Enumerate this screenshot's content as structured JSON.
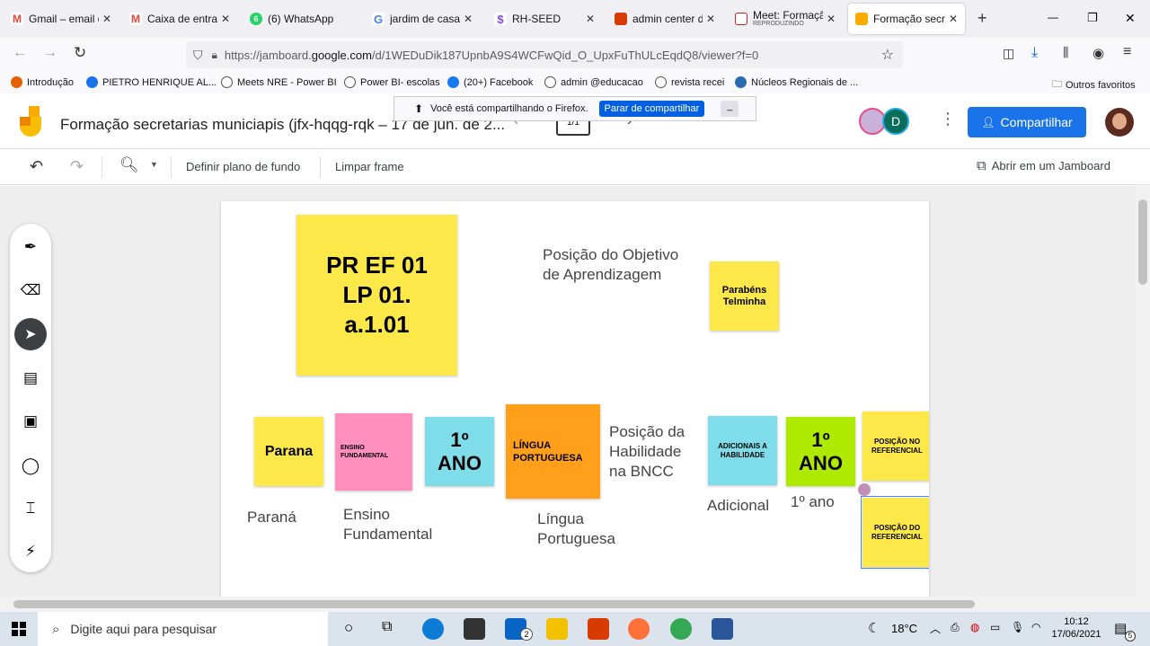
{
  "browser": {
    "tabs": [
      {
        "label": "Gmail – email d",
        "icon": "gmail-icon",
        "color": "#ea4335"
      },
      {
        "label": "Caixa de entrad",
        "icon": "gmail-icon",
        "color": "#ea4335"
      },
      {
        "label": "(6) WhatsApp",
        "icon": "whatsapp-icon",
        "color": "#25d366"
      },
      {
        "label": "jardim de casa d",
        "icon": "google-icon",
        "color": "#4285f4"
      },
      {
        "label": "RH-SEED",
        "icon": "dollar-icon",
        "color": "#7b4fd8"
      },
      {
        "label": "admin center do",
        "icon": "office-icon",
        "color": "#d83b01"
      },
      {
        "label": "Meet: Formação",
        "sublabel": "REPRODUZINDO",
        "icon": "meet-icon",
        "color": "#c5221f"
      },
      {
        "label": "Formação secret",
        "icon": "jamboard-icon",
        "color": "#f9ab00"
      }
    ],
    "new_tab": "+",
    "window": {
      "minimize": "—",
      "restore": "❐",
      "close": "✕"
    },
    "url": {
      "prefix": "https://jamboard.",
      "domain": "google.com",
      "rest": "/d/1WEDuDik187UpnbA9S4WCFwQid_O_UpxFuThULcEqdQ8/viewer?f=0"
    },
    "bookmarks": [
      {
        "label": "Introdução",
        "color": "#e66000"
      },
      {
        "label": "PIETRO HENRIQUE AL...",
        "color": "#1a73e8"
      },
      {
        "label": "Meets NRE - Power BI",
        "color": "#666"
      },
      {
        "label": "Power BI- escolas",
        "color": "#666"
      },
      {
        "label": "(20+) Facebook",
        "color": "#1877f2"
      },
      {
        "label": "admin @educacao",
        "color": "#666"
      },
      {
        "label": "revista recei",
        "color": "#666"
      },
      {
        "label": "Núcleos Regionais de ...",
        "color": "#2b6cb0"
      }
    ],
    "other_bookmarks": "Outros favoritos"
  },
  "share_banner": {
    "text": "Você está compartilhando o Firefox.",
    "button": "Parar de compartilhar",
    "minimize": "_"
  },
  "jamboard": {
    "title": "Formação secretarias municiapis (jfx-hqqg-rqk – 17 de jun. de 2...",
    "frame_counter": "1/1",
    "avatar_letter": "D",
    "share_button": "Compartilhar",
    "toolbar": {
      "set_background": "Definir plano de fundo",
      "clear_frame": "Limpar frame",
      "open_in_jamboard": "Abrir em um Jamboard"
    }
  },
  "frame": {
    "notes": [
      {
        "text": "PR EF 01 LP 01. a.1.01",
        "color": "#fde84a"
      },
      {
        "text": "Parabéns Telminha",
        "color": "#fde84a"
      },
      {
        "text": "Parana",
        "color": "#fde84a"
      },
      {
        "text": "ENSINO FUNDAMENTAL",
        "color": "#ff8fbd"
      },
      {
        "text": "1º ANO",
        "color": "#7fdde9"
      },
      {
        "text": "LÍNGUA PORTUGUESA",
        "color": "#ff9f1a"
      },
      {
        "text": "ADICIONAIS A HABILIDADE",
        "color": "#7fdde9"
      },
      {
        "text": "1º ANO",
        "color": "#aeea00"
      },
      {
        "text": "POSIÇÃO NO REFERENCIAL",
        "color": "#fde84a"
      },
      {
        "text": "POSIÇÃO DO REFERENCIAL",
        "color": "#fde84a"
      }
    ],
    "texts": [
      {
        "text": "Posição do Objetivo de Aprendizagem"
      },
      {
        "text": "Posição da Habilidade na BNCC"
      },
      {
        "text": "Paraná"
      },
      {
        "text": "Ensino Fundamental"
      },
      {
        "text": "Língua Portuguesa"
      },
      {
        "text": "Adicional"
      },
      {
        "text": "1º ano"
      }
    ]
  },
  "taskbar": {
    "search_placeholder": "Digite aqui para pesquisar",
    "weather": "18°C",
    "time": "10:12",
    "date": "17/06/2021",
    "mail_badge": "2",
    "notification_count": "5"
  }
}
